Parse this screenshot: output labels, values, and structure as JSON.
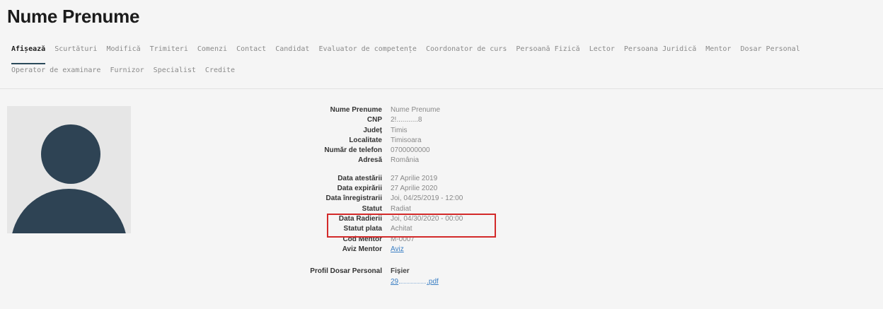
{
  "page": {
    "title": "Nume Prenume"
  },
  "tabs": {
    "row1": [
      "Afișează",
      "Scurtături",
      "Modifică",
      "Trimiteri",
      "Comenzi",
      "Contact",
      "Candidat",
      "Evaluator de competențe",
      "Coordonator de curs",
      "Persoană Fizică",
      "Lector",
      "Persoana Juridică",
      "Mentor",
      "Dosar Personal"
    ],
    "row2": [
      "Operator de examinare",
      "Furnizor",
      "Specialist",
      "Credite"
    ],
    "active": "Afișează"
  },
  "profile": {
    "group1": [
      {
        "label": "Nume Prenume",
        "value": "Nume Prenume"
      },
      {
        "label": "CNP",
        "value": "2!...........8"
      },
      {
        "label": "Județ",
        "value": "Timis"
      },
      {
        "label": "Localitate",
        "value": "Timisoara"
      },
      {
        "label": "Număr de telefon",
        "value": "0700000000"
      },
      {
        "label": "Adresă",
        "value": "România"
      }
    ],
    "group2": [
      {
        "label": "Data atestării",
        "value": "27 Aprilie 2019"
      },
      {
        "label": "Data expirării",
        "value": "27 Aprilie 2020"
      },
      {
        "label": "Data înregistrarii",
        "value": "Joi, 04/25/2019 - 12:00"
      },
      {
        "label": "Statut",
        "value": "Radiat"
      },
      {
        "label": "Data Radierii",
        "value": "Joi, 04/30/2020 - 00:00"
      },
      {
        "label": "Statut plata",
        "value": "Achitat"
      },
      {
        "label": "Cod Mentor",
        "value": "M-0007"
      },
      {
        "label": "Aviz Mentor",
        "value": "Aviz"
      }
    ],
    "dosar": {
      "label": "Profil Dosar Personal",
      "file_header": "Fișier",
      "file_prefix": "29",
      "file_ext": "pdf"
    }
  },
  "highlight_color": "#d32a2a"
}
